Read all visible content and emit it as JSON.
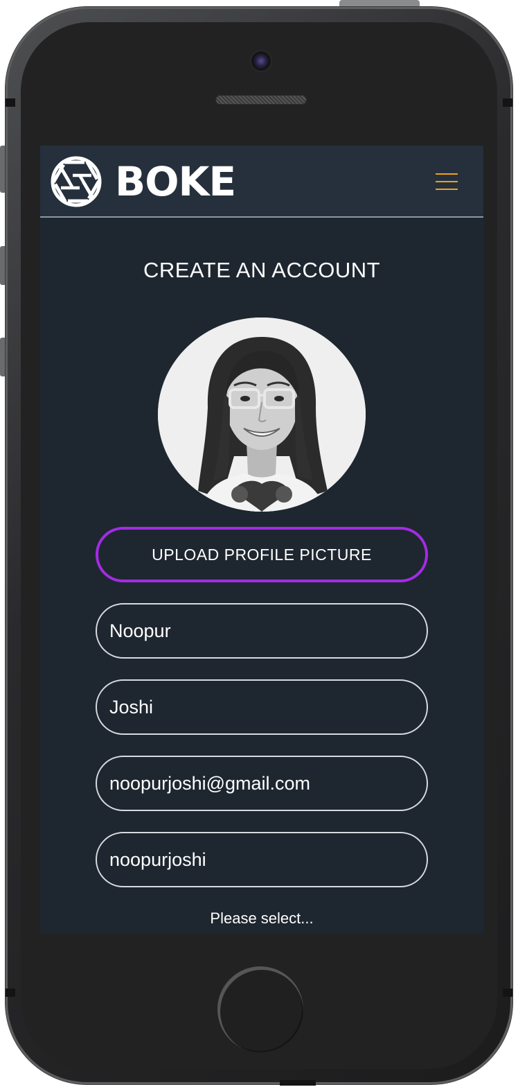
{
  "header": {
    "brand": "BOKE",
    "logo_icon": "camera-aperture-icon",
    "menu_icon": "hamburger-menu-icon",
    "accent_color": "#f0a21a"
  },
  "page": {
    "title": "CREATE AN ACCOUNT"
  },
  "profile": {
    "avatar": "profile-photo",
    "upload_label": "UPLOAD PROFILE PICTURE",
    "upload_border_color": "#a42be5"
  },
  "form": {
    "first_name": "Noopur",
    "last_name": "Joshi",
    "email": "noopurjoshi@gmail.com",
    "username": "noopurjoshi",
    "select_placeholder": "Please select..."
  },
  "theme": {
    "background": "#1e2730",
    "header_background": "#25303c"
  }
}
